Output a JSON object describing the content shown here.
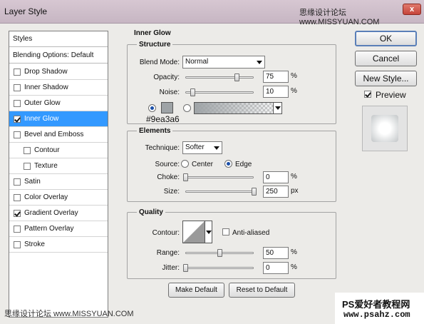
{
  "window": {
    "title": "Layer Style",
    "watermark": "思缘设计论坛 www.MISSYUAN.COM",
    "close_label": "x"
  },
  "left_panel": {
    "styles_label": "Styles",
    "blending_label": "Blending Options: Default",
    "items": [
      {
        "label": "Drop Shadow",
        "checked": false,
        "selected": false,
        "indent": false
      },
      {
        "label": "Inner Shadow",
        "checked": false,
        "selected": false,
        "indent": false
      },
      {
        "label": "Outer Glow",
        "checked": false,
        "selected": false,
        "indent": false
      },
      {
        "label": "Inner Glow",
        "checked": true,
        "selected": true,
        "indent": false
      },
      {
        "label": "Bevel and Emboss",
        "checked": false,
        "selected": false,
        "indent": false
      },
      {
        "label": "Contour",
        "checked": false,
        "selected": false,
        "indent": true
      },
      {
        "label": "Texture",
        "checked": false,
        "selected": false,
        "indent": true
      },
      {
        "label": "Satin",
        "checked": false,
        "selected": false,
        "indent": false
      },
      {
        "label": "Color Overlay",
        "checked": false,
        "selected": false,
        "indent": false
      },
      {
        "label": "Gradient Overlay",
        "checked": true,
        "selected": false,
        "indent": false
      },
      {
        "label": "Pattern Overlay",
        "checked": false,
        "selected": false,
        "indent": false
      },
      {
        "label": "Stroke",
        "checked": false,
        "selected": false,
        "indent": false
      }
    ]
  },
  "inner_glow": {
    "title": "Inner Glow",
    "structure": {
      "title": "Structure",
      "blend_mode_label": "Blend Mode:",
      "blend_mode_value": "Normal",
      "opacity_label": "Opacity:",
      "opacity_value": "75",
      "opacity_fraction": 0.75,
      "noise_label": "Noise:",
      "noise_value": "10",
      "noise_fraction": 0.1,
      "percent": "%",
      "color_hex": "#9ea3a6"
    },
    "elements": {
      "title": "Elements",
      "technique_label": "Technique:",
      "technique_value": "Softer",
      "source_label": "Source:",
      "source_center": "Center",
      "source_edge": "Edge",
      "choke_label": "Choke:",
      "choke_value": "0",
      "choke_fraction": 0,
      "size_label": "Size:",
      "size_value": "250",
      "size_fraction": 1,
      "percent": "%",
      "px": "px"
    },
    "quality": {
      "title": "Quality",
      "contour_label": "Contour:",
      "antialiased_label": "Anti-aliased",
      "range_label": "Range:",
      "range_value": "50",
      "range_fraction": 0.5,
      "jitter_label": "Jitter:",
      "jitter_value": "0",
      "jitter_fraction": 0,
      "percent": "%"
    },
    "make_default_label": "Make Default",
    "reset_default_label": "Reset to Default"
  },
  "buttons": {
    "ok_label": "OK",
    "cancel_label": "Cancel",
    "new_style_label": "New Style...",
    "preview_label": "Preview"
  },
  "footer": {
    "left_watermark": "思缘设计论坛 www.MISSYUAN.COM",
    "right_watermark_top": "PS爱好者教程网",
    "right_watermark_bottom": "www.psahz.com"
  },
  "colors": {
    "selected_row": "#3399ff",
    "glow_color": "#9ea3a6"
  }
}
